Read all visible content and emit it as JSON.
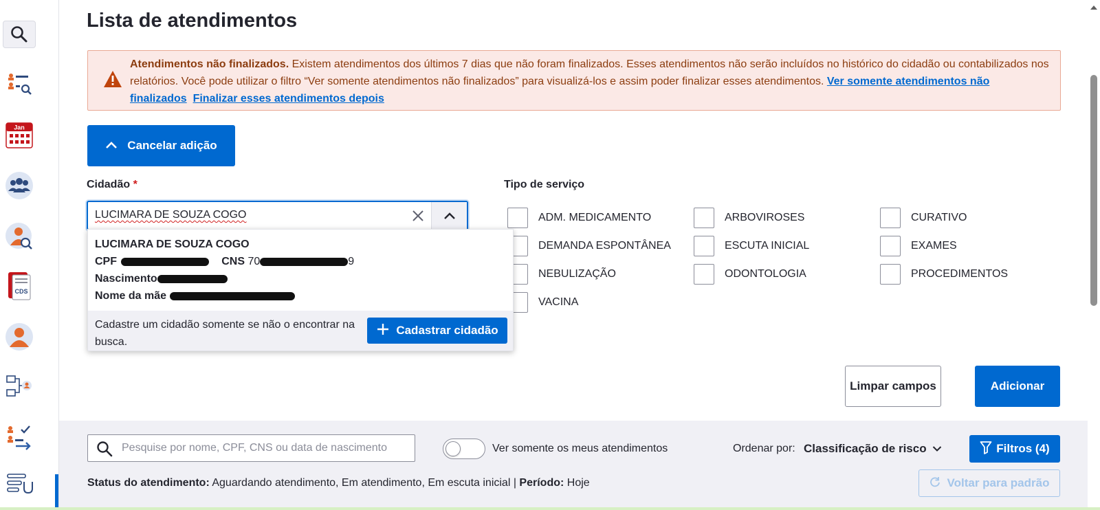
{
  "page": {
    "title": "Lista de atendimentos"
  },
  "sidebar": {
    "items": [
      {
        "name": "search-icon"
      },
      {
        "name": "patient-search-icon"
      },
      {
        "name": "calendar-icon",
        "label": "Jan"
      },
      {
        "name": "group-icon"
      },
      {
        "name": "citizen-search-icon"
      },
      {
        "name": "cds-icon",
        "label": "CDS"
      },
      {
        "name": "person-icon"
      },
      {
        "name": "flow-icon"
      },
      {
        "name": "checklist-icon"
      },
      {
        "name": "stethoscope-list-icon"
      }
    ]
  },
  "alert": {
    "bold": "Atendimentos não finalizados.",
    "text": " Existem atendimentos dos últimos 7 dias que não foram finalizados. Esses atendimentos não serão incluídos no histórico do cidadão ou contabilizados nos relatórios. Você pode utilizar o filtro “Ver somente atendimentos não finalizados” para visualizá-los e assim poder finalizar esses atendimentos. ",
    "link1": "Ver somente atendimentos não finalizados",
    "link2": "Finalizar esses atendimentos depois"
  },
  "form": {
    "cancel_label": "Cancelar adição",
    "citizen_label": "Cidadão",
    "required_mark": "*",
    "citizen_value": "LUCIMARA DE SOUZA COGO",
    "service_label": "Tipo de serviço",
    "services": [
      "ADM. MEDICAMENTO",
      "ARBOVIROSES",
      "CURATIVO",
      "DEMANDA ESPONTÂNEA",
      "ESCUTA INICIAL",
      "EXAMES",
      "NEBULIZAÇÃO",
      "ODONTOLOGIA",
      "PROCEDIMENTOS",
      "VACINA"
    ],
    "clear_label": "Limpar campos",
    "add_label": "Adicionar"
  },
  "dropdown": {
    "name": "LUCIMARA DE SOUZA COGO",
    "cpf_label": "CPF",
    "cns_label": "CNS",
    "cns_prefix": "70",
    "cns_suffix": "9",
    "birth_label": "Nascimento",
    "mother_label": "Nome da mãe",
    "footer_text": "Cadastre um cidadão somente se não o encontrar na busca.",
    "register_label": "Cadastrar cidadão"
  },
  "filters": {
    "search_placeholder": "Pesquise por nome, CPF, CNS ou data de nascimento",
    "toggle_label": "Ver somente os meus atendimentos",
    "order_label": "Ordenar por:",
    "order_value": "Classificação de risco",
    "filters_label": "Filtros (4)",
    "status_label": "Status do atendimento:",
    "status_value": " Aguardando atendimento, Em atendimento, Em escuta inicial",
    "separator": " | ",
    "period_label": "Período:",
    "period_value": " Hoje",
    "reset_label": "Voltar para padrão"
  },
  "colors": {
    "primary": "#0069d0",
    "alert_bg": "#fbe9e6",
    "alert_border": "#e9a894",
    "alert_text": "#8c3d10",
    "warning_icon": "#c0440c",
    "filter_bar_bg": "#f0f0f5"
  }
}
